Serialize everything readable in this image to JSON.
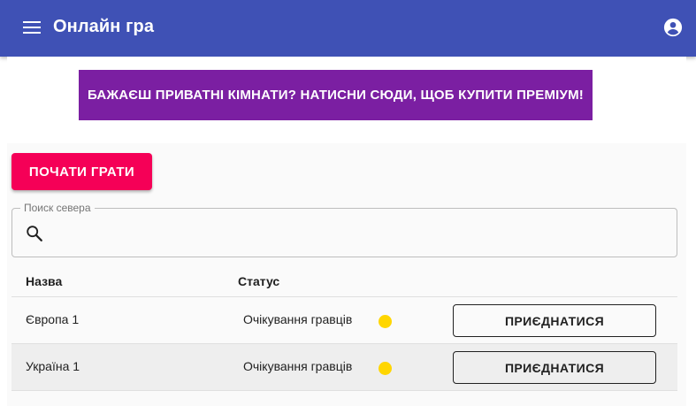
{
  "appbar": {
    "title": "Онлайн гра",
    "menu_icon": "menu-icon",
    "account_icon": "account-circle-icon",
    "color": "#3f51b5"
  },
  "banner": {
    "text": "БАЖАЄШ ПРИВАТНІ КІМНАТИ? НАТИСНИ СЮДИ, ЩОБ КУПИТИ ПРЕМІУМ!",
    "color": "#7b1fa2"
  },
  "start_button": {
    "label": "ПОЧАТИ ГРАТИ",
    "color": "#f50057"
  },
  "search": {
    "label": "Поиск севера",
    "value": "",
    "icon": "search-icon"
  },
  "table": {
    "columns": [
      "Назва",
      "Статус"
    ],
    "rows": [
      {
        "name": "Європа 1",
        "status": "Очікування гравців",
        "status_color": "#ffd600",
        "action": "ПРИЄДНАТИСЯ"
      },
      {
        "name": "Україна 1",
        "status": "Очікування гравців",
        "status_color": "#ffd600",
        "action": "ПРИЄДНАТИСЯ"
      }
    ]
  }
}
